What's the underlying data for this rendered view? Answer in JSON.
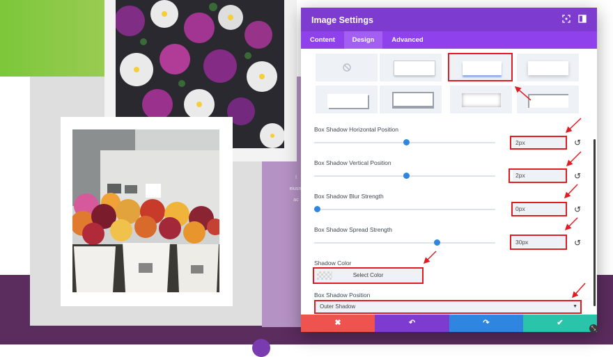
{
  "modal": {
    "title": "Image Settings",
    "header_icons": [
      "fullscreen-icon",
      "split-view-icon"
    ],
    "tabs": [
      {
        "label": "Content",
        "active": false
      },
      {
        "label": "Design",
        "active": true
      },
      {
        "label": "Advanced",
        "active": false
      }
    ],
    "fields": {
      "horizontal": {
        "label": "Box Shadow Horizontal Position",
        "value": "2px"
      },
      "vertical": {
        "label": "Box Shadow Vertical Position",
        "value": "2px"
      },
      "blur": {
        "label": "Box Shadow Blur Strength",
        "value": "0px"
      },
      "spread": {
        "label": "Box Shadow Spread Strength",
        "value": "30px"
      }
    },
    "shadow_color": {
      "label": "Shadow Color",
      "button_label": "Select Color"
    },
    "shadow_position": {
      "label": "Box Shadow Position",
      "value": "Outer Shadow"
    },
    "footer": {
      "cancel": "✖",
      "undo": "↶",
      "redo": "↷",
      "save": "✔"
    }
  },
  "background": {
    "purple_panel_text": [
      "l",
      "eiusm",
      "ac"
    ]
  },
  "colors": {
    "header": "#7e3bd0",
    "tabs": "#8f42ec",
    "cancel": "#ef5350",
    "undo": "#7e3bd0",
    "redo": "#2e86e0",
    "save": "#29c4a9",
    "highlight": "#e11b22"
  }
}
